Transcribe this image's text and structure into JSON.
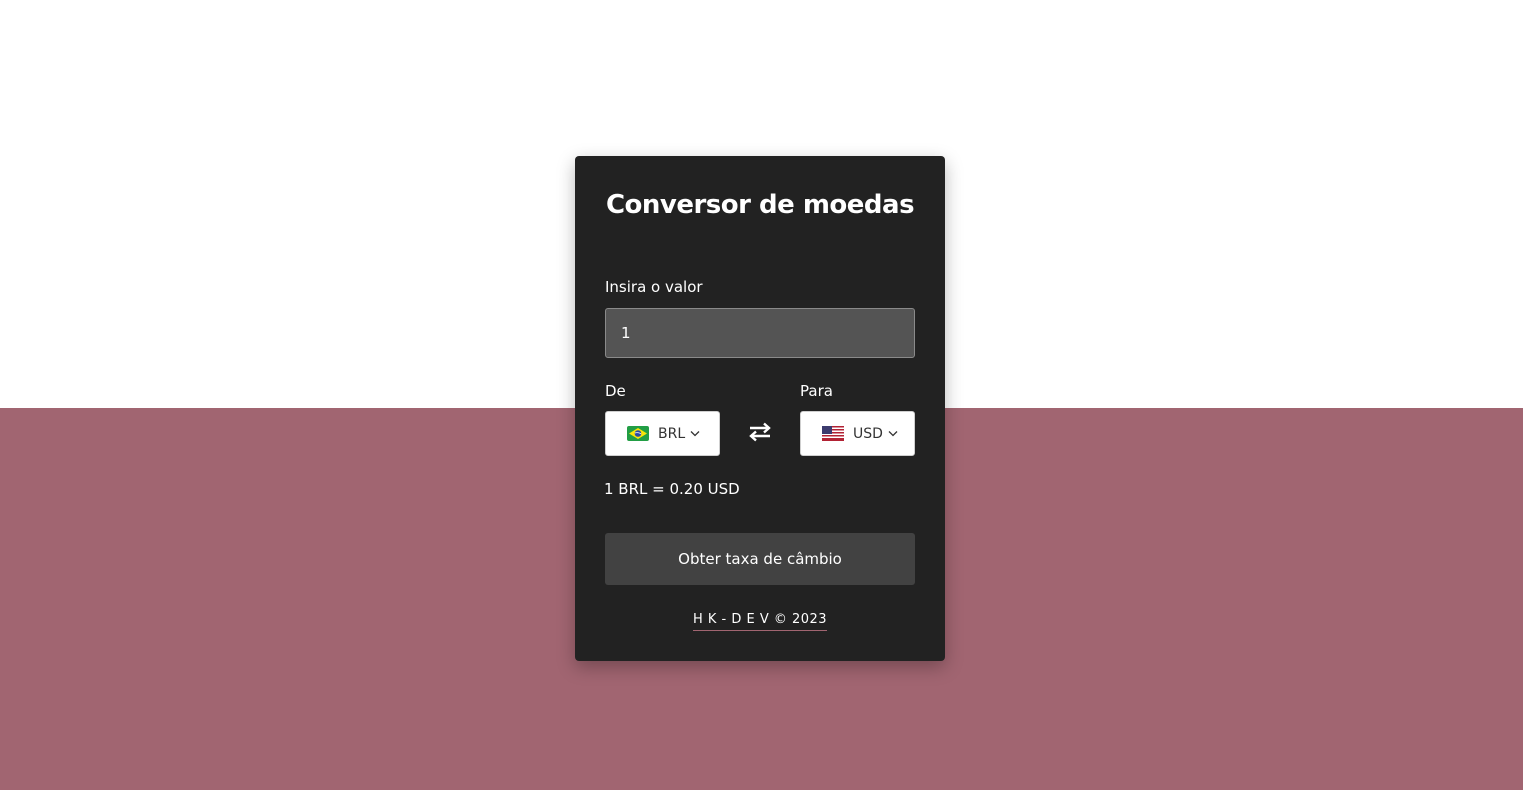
{
  "colors": {
    "background_top": "#ffffff",
    "background_bottom": "#a16571",
    "card": "#222222",
    "input": "#545454",
    "button": "#424242"
  },
  "card": {
    "title": "Conversor de moedas",
    "amount": {
      "label": "Insira o valor",
      "value": "1"
    },
    "from": {
      "label": "De",
      "currency": "BRL",
      "flag_icon": "brazil-flag-icon"
    },
    "swap_icon": "swap-arrows-icon",
    "to": {
      "label": "Para",
      "currency": "USD",
      "flag_icon": "us-flag-icon"
    },
    "rate_text": "1 BRL = 0.20 USD",
    "button_label": "Obter taxa de câmbio",
    "footer": "H K - D E V © 2023"
  }
}
